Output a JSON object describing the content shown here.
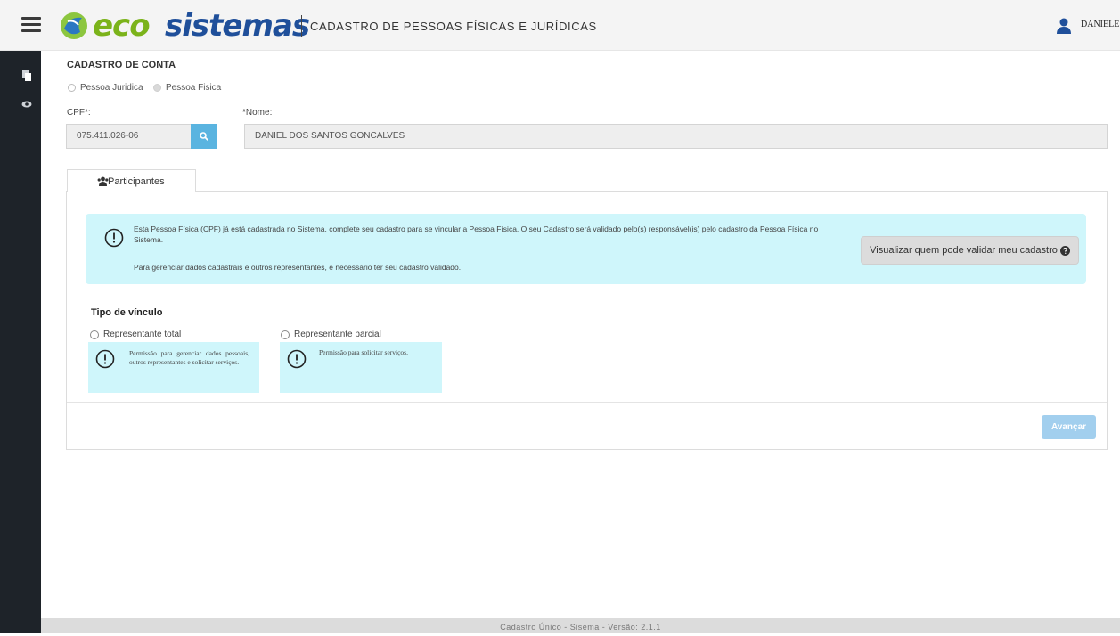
{
  "header": {
    "logo_part1": "eco",
    "logo_part2": "sistemas",
    "subtitle": "CADASTRO DE PESSOAS FÍSICAS E JURÍDICAS",
    "user_name": "DANIELE"
  },
  "form": {
    "title": "CADASTRO DE CONTA",
    "person_types": [
      "Pessoa Juridica",
      "Pessoa Fisica"
    ],
    "selected_person_type": "Pessoa Fisica",
    "cpf_label": "CPF*:",
    "cpf_value": "075.411.026-06",
    "nome_label": "*Nome:",
    "nome_value": "DANIEL DOS SANTOS GONCALVES"
  },
  "tabs": {
    "participantes_label": "Participantes"
  },
  "alert": {
    "message_line1": "Esta Pessoa Física (CPF) já está cadastrada no Sistema, complete seu cadastro para se vincular a Pessoa Física. O seu Cadastro será validado pelo(s) responsável(is) pelo cadastro da Pessoa Física no Sistema.",
    "message_line2": "Para gerenciar dados cadastrais e outros representantes, é necessário ter seu cadastro validado.",
    "validate_button": "Visualizar quem pode validar meu cadastro"
  },
  "vinculo": {
    "title": "Tipo de vínculo",
    "options": [
      {
        "label": "Representante total",
        "description": "Permissão para gerenciar dados pessoais, outros representantes e solicitar serviços."
      },
      {
        "label": "Representante parcial",
        "description": "Permissão para solicitar serviços."
      }
    ]
  },
  "actions": {
    "next_button": "Avançar"
  },
  "footer": {
    "text": "Cadastro Único - Sisema - Versão: 2.1.1"
  },
  "colors": {
    "brand_green": "#7bb31a",
    "brand_blue": "#1f4f9a",
    "accent": "#5ab4e0",
    "info_bg": "#cff6fb",
    "rail": "#1e2329"
  },
  "icons": [
    "menu-icon",
    "ecosistemas-logo-icon",
    "user-icon",
    "copy-icon",
    "eye-icon",
    "search-icon",
    "users-icon",
    "exclamation-circle-icon",
    "question-circle-icon"
  ]
}
